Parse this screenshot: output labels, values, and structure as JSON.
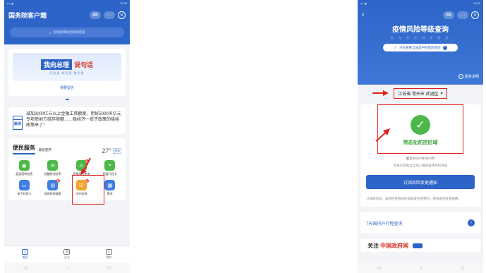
{
  "left_phone": {
    "status_time": "10:28",
    "app_title": "国务院客户端",
    "search_placeholder": "各地疫情防控政策措施",
    "banner_main_a": "我向总理",
    "banner_main_b": "说句话",
    "banner_sub": "同民意 知民意 聚民智",
    "leave_message_label": "我要留言",
    "news_badge": "解读",
    "news_text": "减加3000亿元以上金融工具额度、用好5000多亿元专项债地方结存限额……稳经济一揽子政策的接续政策来了！",
    "services_title": "便民服务",
    "services_recent": "最近使用",
    "weather_temp": "27°",
    "weather_tag": "多云",
    "services": [
      {
        "label": "疫苗接种信息",
        "color": "#4cb848",
        "icon": "▣",
        "badge": ""
      },
      {
        "label": "核酸检测证明",
        "color": "#4cb848",
        "icon": "✉",
        "badge": ""
      },
      {
        "label": "疫情风险查询",
        "color": "#4cb848",
        "icon": "⚠",
        "badge": "热"
      },
      {
        "label": "防疫行程卡",
        "color": "#4cb848",
        "icon": "⌖",
        "badge": ""
      },
      {
        "label": "电子社保卡",
        "color": "#3f7fe0",
        "icon": "▭",
        "badge": ""
      },
      {
        "label": "各地防控政策",
        "color": "#3f7fe0",
        "icon": "▤",
        "badge": "新"
      },
      {
        "label": "出行安排",
        "color": "#f0a52a",
        "icon": "☑",
        "badge": "新"
      },
      {
        "label": "更多",
        "color": "#3f7fe0",
        "icon": "▦",
        "badge": ""
      }
    ],
    "tabs": [
      {
        "label": "首页",
        "icon": "⌂",
        "active": true
      },
      {
        "label": "企业",
        "icon": "▥",
        "active": false
      },
      {
        "label": "我的",
        "icon": "♙",
        "active": false
      }
    ],
    "nav_buttons": [
      "◁",
      "○",
      "□"
    ]
  },
  "right_phone": {
    "status_time": "10:30",
    "page_title": "疫情风险等级查询",
    "page_subtitle": "同 舟 共 济 科 学 防 控",
    "national_link": "点击查看全国高中低风险地区",
    "service_info": "服务说明",
    "location": "江苏省 常州市 武进区",
    "risk_level": "常态化防控区域",
    "cutoff": "截至2022-09-08 9时",
    "source_note": "有关信息来自当地上报的疫情风险等级",
    "subscribe_label": "订阅风险变更通知",
    "subscribe_tip": "订阅成功后，该地区疫情风险等级发生变更时，将会收到变更提醒。",
    "trip_label": "7天国内外行程查询",
    "follow_a": "关注",
    "follow_b": "中国政府网",
    "nav_buttons": [
      "◁",
      "○",
      "□"
    ]
  },
  "annotation_color": "#e02020"
}
